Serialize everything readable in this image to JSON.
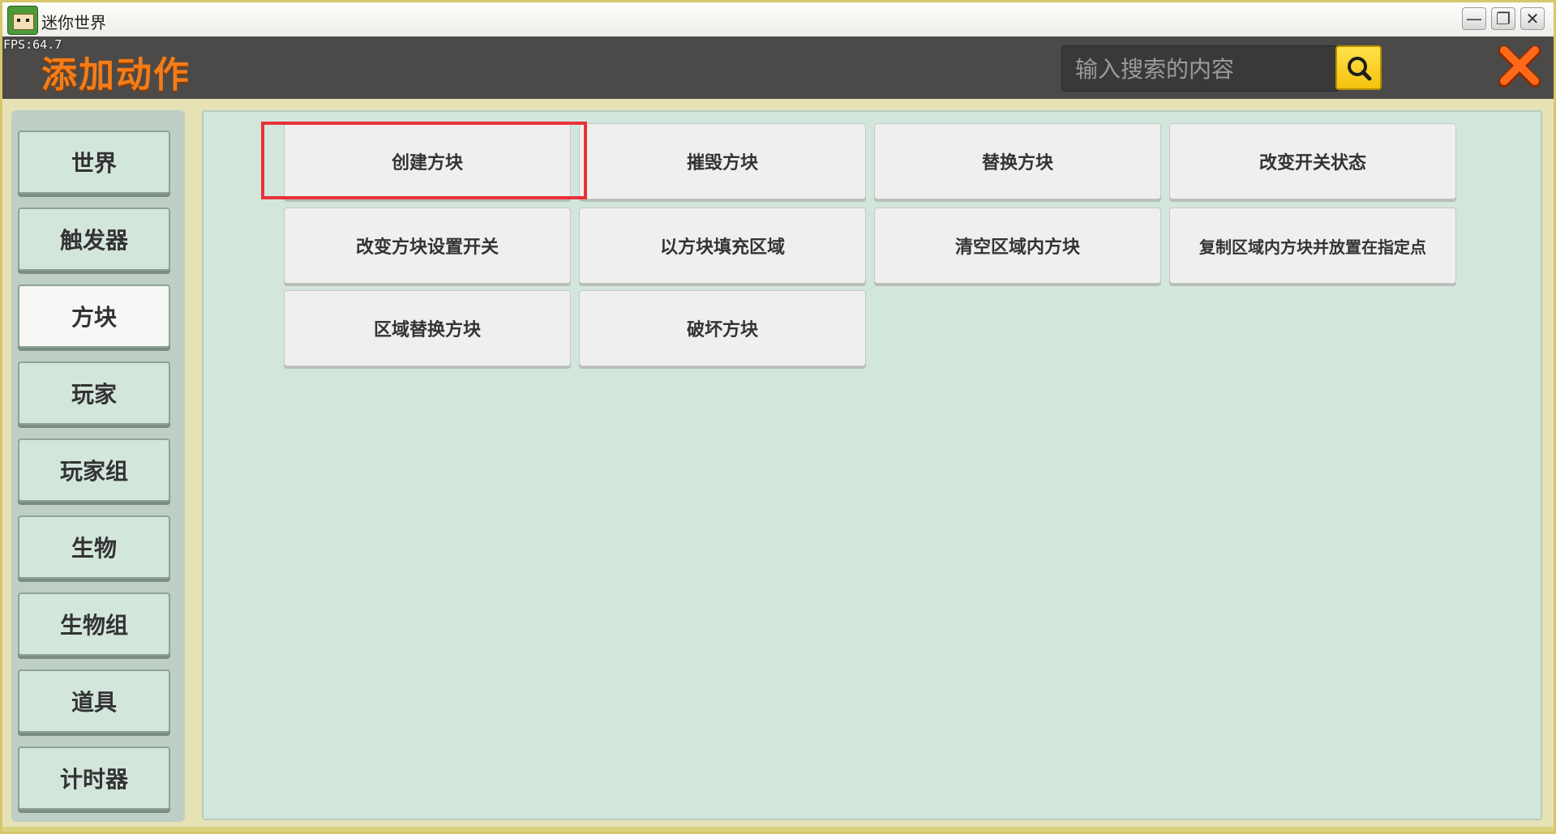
{
  "window": {
    "app_title": "迷你世界",
    "fps": "FPS:64.7",
    "minimize_glyph": "—",
    "restore_glyph": "❐",
    "close_glyph": "✕"
  },
  "header": {
    "title": "添加动作",
    "search_placeholder": "输入搜索的内容",
    "accent_color": "#f47c18",
    "search_button_color": "#f5c20c"
  },
  "sidebar": {
    "items": [
      {
        "label": "世界",
        "selected": false
      },
      {
        "label": "触发器",
        "selected": false
      },
      {
        "label": "方块",
        "selected": true
      },
      {
        "label": "玩家",
        "selected": false
      },
      {
        "label": "玩家组",
        "selected": false
      },
      {
        "label": "生物",
        "selected": false
      },
      {
        "label": "生物组",
        "selected": false
      },
      {
        "label": "道具",
        "selected": false
      },
      {
        "label": "计时器",
        "selected": false
      }
    ]
  },
  "actions": {
    "items": [
      {
        "label": "创建方块",
        "highlighted": true
      },
      {
        "label": "摧毁方块"
      },
      {
        "label": "替换方块"
      },
      {
        "label": "改变开关状态"
      },
      {
        "label": "改变方块设置开关"
      },
      {
        "label": "以方块填充区域"
      },
      {
        "label": "清空区域内方块"
      },
      {
        "label": "复制区域内方块并放置在指定点"
      },
      {
        "label": "区域替换方块"
      },
      {
        "label": "破坏方块"
      }
    ],
    "highlight_color": "#e8323a"
  }
}
